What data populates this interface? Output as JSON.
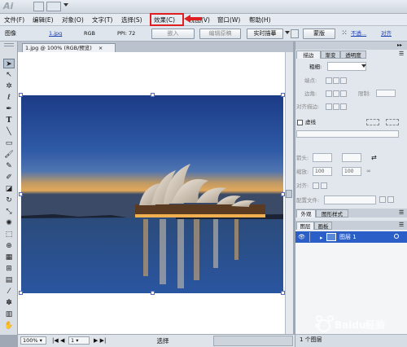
{
  "app": {
    "logo": "Ai"
  },
  "menu": [
    "文件(F)",
    "编辑(E)",
    "对象(O)",
    "文字(T)",
    "选择(S)",
    "效果(C)",
    "视图(V)",
    "窗口(W)",
    "帮助(H)"
  ],
  "control_bar": {
    "object_type": "图像",
    "file_link": "1.jpg",
    "color_mode": "RGB",
    "ppi": "PPI: 72",
    "embed": "嵌入",
    "edit_original": "编辑原稿",
    "live_trace": "实时描摹",
    "mask": "蒙版",
    "opacity_label": "不透...",
    "align": "对齐"
  },
  "document": {
    "tab_title": "1.jpg @ 100% (RGB/预览)",
    "close": "×"
  },
  "panel_stroke": {
    "tabs": [
      "描边",
      "渐变",
      "透明度"
    ],
    "weight_label": "粗细:",
    "cap_label": "端点:",
    "corner_label": "边角:",
    "limit_label": "限制:",
    "align_label": "对齐描边:",
    "dashed_label": "虚线",
    "arrow_label": "箭头:",
    "scale_label": "缩放:",
    "scale_start": "100",
    "scale_end": "100",
    "align2_label": "对齐:",
    "profile_label": "配置文件:"
  },
  "panel_appearance": {
    "tabs": [
      "外观",
      "图形样式"
    ]
  },
  "panel_layers": {
    "tabs": [
      "图层",
      "画板"
    ],
    "layers": [
      {
        "name": "图层 1",
        "visible": true
      }
    ],
    "count": "1 个图层"
  },
  "status": {
    "zoom": "100%",
    "artboard": "1",
    "tool_name": "选择"
  },
  "colors": {
    "highlight": "#e02020",
    "layer_selected": "#2b5fc7"
  }
}
